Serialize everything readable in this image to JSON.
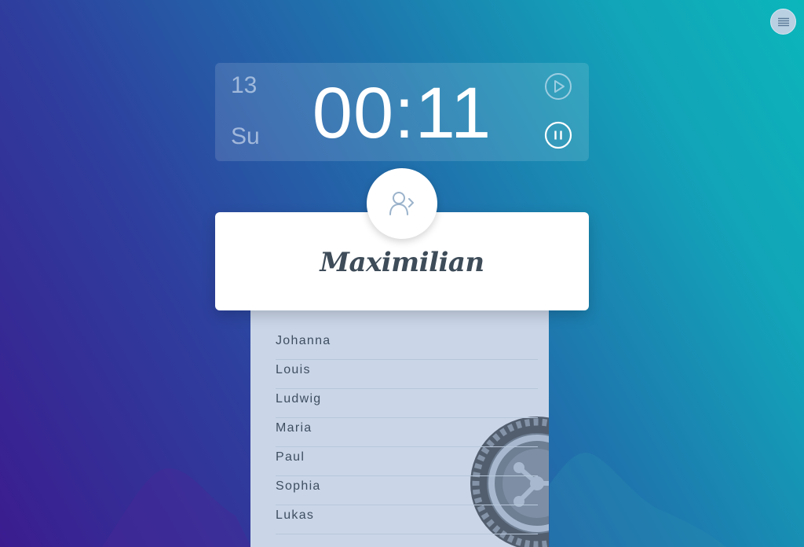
{
  "menu": {
    "icon": "hamburger-menu-icon"
  },
  "timer": {
    "date_number": "13",
    "day_abbrev": "Su",
    "time": "00:11",
    "play_icon": "play-circle-icon",
    "pause_icon": "pause-circle-icon"
  },
  "selection": {
    "avatar_icon": "user-next-icon",
    "name": "Maximilian"
  },
  "name_list": {
    "items": [
      "Johanna",
      "Louis",
      "Ludwig",
      "Maria",
      "Paul",
      "Sophia",
      "Lukas"
    ]
  },
  "decorations": {
    "wheel_icon": "roulette-wheel-icon"
  },
  "colors": {
    "background_start": "#3b1c8f",
    "background_end": "#0bb6bb",
    "card": "#ffffff",
    "list_bg": "#cad6e8",
    "name_text": "#3e4c59"
  }
}
